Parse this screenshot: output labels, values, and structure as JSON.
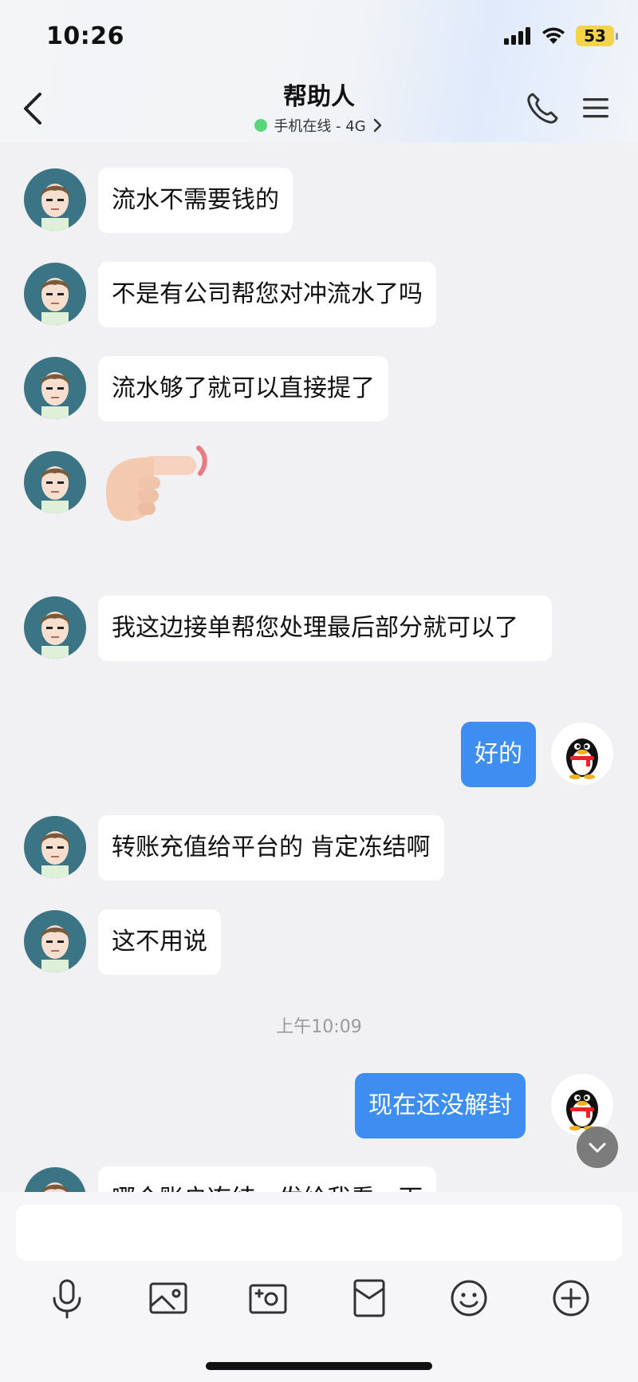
{
  "status_bar": {
    "time": "10:26",
    "battery": "53"
  },
  "header": {
    "title": "帮助人",
    "presence": "手机在线 - 4G"
  },
  "messages": [
    {
      "text": "流水不需要钱的"
    },
    {
      "text": "不是有公司帮您对冲流水了吗"
    },
    {
      "text": "流水够了就可以直接提了"
    },
    {
      "emoji": "pointing-finger-emoji"
    },
    {
      "text": "我这边接单帮您处理最后部分就可以了"
    },
    {
      "text": "好的"
    },
    {
      "text": "转账充值给平台的 肯定冻结啊"
    },
    {
      "text": "这不用说"
    },
    {
      "text": "现在还没解封"
    },
    {
      "text": "哪个账户冻结，发给我看一下"
    }
  ],
  "time_separator": "上午10:09",
  "input": {
    "placeholder": ""
  },
  "colors": {
    "outgoing_bubble": "#3d8ef0",
    "incoming_bubble": "#ffffff",
    "background": "#f1f1f3"
  }
}
